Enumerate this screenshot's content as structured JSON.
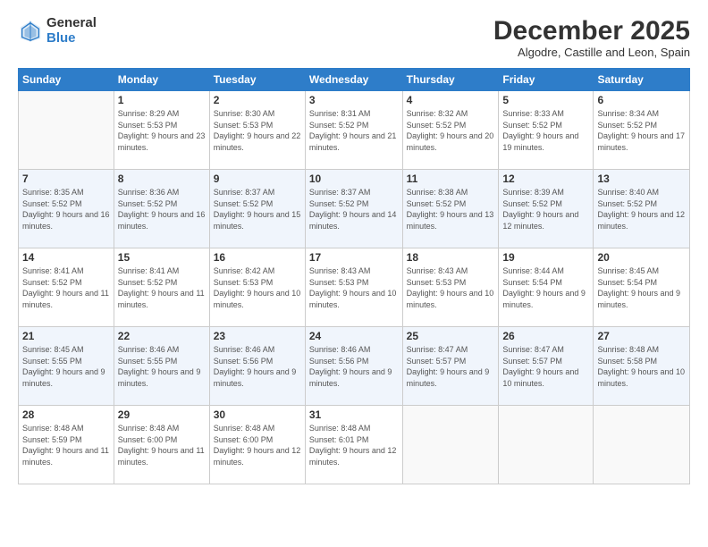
{
  "header": {
    "logo_general": "General",
    "logo_blue": "Blue",
    "month_title": "December 2025",
    "subtitle": "Algodre, Castille and Leon, Spain"
  },
  "weekdays": [
    "Sunday",
    "Monday",
    "Tuesday",
    "Wednesday",
    "Thursday",
    "Friday",
    "Saturday"
  ],
  "weeks": [
    [
      {
        "day": "",
        "sunrise": "",
        "sunset": "",
        "daylight": ""
      },
      {
        "day": "1",
        "sunrise": "Sunrise: 8:29 AM",
        "sunset": "Sunset: 5:53 PM",
        "daylight": "Daylight: 9 hours and 23 minutes."
      },
      {
        "day": "2",
        "sunrise": "Sunrise: 8:30 AM",
        "sunset": "Sunset: 5:53 PM",
        "daylight": "Daylight: 9 hours and 22 minutes."
      },
      {
        "day": "3",
        "sunrise": "Sunrise: 8:31 AM",
        "sunset": "Sunset: 5:52 PM",
        "daylight": "Daylight: 9 hours and 21 minutes."
      },
      {
        "day": "4",
        "sunrise": "Sunrise: 8:32 AM",
        "sunset": "Sunset: 5:52 PM",
        "daylight": "Daylight: 9 hours and 20 minutes."
      },
      {
        "day": "5",
        "sunrise": "Sunrise: 8:33 AM",
        "sunset": "Sunset: 5:52 PM",
        "daylight": "Daylight: 9 hours and 19 minutes."
      },
      {
        "day": "6",
        "sunrise": "Sunrise: 8:34 AM",
        "sunset": "Sunset: 5:52 PM",
        "daylight": "Daylight: 9 hours and 17 minutes."
      }
    ],
    [
      {
        "day": "7",
        "sunrise": "Sunrise: 8:35 AM",
        "sunset": "Sunset: 5:52 PM",
        "daylight": "Daylight: 9 hours and 16 minutes."
      },
      {
        "day": "8",
        "sunrise": "Sunrise: 8:36 AM",
        "sunset": "Sunset: 5:52 PM",
        "daylight": "Daylight: 9 hours and 16 minutes."
      },
      {
        "day": "9",
        "sunrise": "Sunrise: 8:37 AM",
        "sunset": "Sunset: 5:52 PM",
        "daylight": "Daylight: 9 hours and 15 minutes."
      },
      {
        "day": "10",
        "sunrise": "Sunrise: 8:37 AM",
        "sunset": "Sunset: 5:52 PM",
        "daylight": "Daylight: 9 hours and 14 minutes."
      },
      {
        "day": "11",
        "sunrise": "Sunrise: 8:38 AM",
        "sunset": "Sunset: 5:52 PM",
        "daylight": "Daylight: 9 hours and 13 minutes."
      },
      {
        "day": "12",
        "sunrise": "Sunrise: 8:39 AM",
        "sunset": "Sunset: 5:52 PM",
        "daylight": "Daylight: 9 hours and 12 minutes."
      },
      {
        "day": "13",
        "sunrise": "Sunrise: 8:40 AM",
        "sunset": "Sunset: 5:52 PM",
        "daylight": "Daylight: 9 hours and 12 minutes."
      }
    ],
    [
      {
        "day": "14",
        "sunrise": "Sunrise: 8:41 AM",
        "sunset": "Sunset: 5:52 PM",
        "daylight": "Daylight: 9 hours and 11 minutes."
      },
      {
        "day": "15",
        "sunrise": "Sunrise: 8:41 AM",
        "sunset": "Sunset: 5:52 PM",
        "daylight": "Daylight: 9 hours and 11 minutes."
      },
      {
        "day": "16",
        "sunrise": "Sunrise: 8:42 AM",
        "sunset": "Sunset: 5:53 PM",
        "daylight": "Daylight: 9 hours and 10 minutes."
      },
      {
        "day": "17",
        "sunrise": "Sunrise: 8:43 AM",
        "sunset": "Sunset: 5:53 PM",
        "daylight": "Daylight: 9 hours and 10 minutes."
      },
      {
        "day": "18",
        "sunrise": "Sunrise: 8:43 AM",
        "sunset": "Sunset: 5:53 PM",
        "daylight": "Daylight: 9 hours and 10 minutes."
      },
      {
        "day": "19",
        "sunrise": "Sunrise: 8:44 AM",
        "sunset": "Sunset: 5:54 PM",
        "daylight": "Daylight: 9 hours and 9 minutes."
      },
      {
        "day": "20",
        "sunrise": "Sunrise: 8:45 AM",
        "sunset": "Sunset: 5:54 PM",
        "daylight": "Daylight: 9 hours and 9 minutes."
      }
    ],
    [
      {
        "day": "21",
        "sunrise": "Sunrise: 8:45 AM",
        "sunset": "Sunset: 5:55 PM",
        "daylight": "Daylight: 9 hours and 9 minutes."
      },
      {
        "day": "22",
        "sunrise": "Sunrise: 8:46 AM",
        "sunset": "Sunset: 5:55 PM",
        "daylight": "Daylight: 9 hours and 9 minutes."
      },
      {
        "day": "23",
        "sunrise": "Sunrise: 8:46 AM",
        "sunset": "Sunset: 5:56 PM",
        "daylight": "Daylight: 9 hours and 9 minutes."
      },
      {
        "day": "24",
        "sunrise": "Sunrise: 8:46 AM",
        "sunset": "Sunset: 5:56 PM",
        "daylight": "Daylight: 9 hours and 9 minutes."
      },
      {
        "day": "25",
        "sunrise": "Sunrise: 8:47 AM",
        "sunset": "Sunset: 5:57 PM",
        "daylight": "Daylight: 9 hours and 9 minutes."
      },
      {
        "day": "26",
        "sunrise": "Sunrise: 8:47 AM",
        "sunset": "Sunset: 5:57 PM",
        "daylight": "Daylight: 9 hours and 10 minutes."
      },
      {
        "day": "27",
        "sunrise": "Sunrise: 8:48 AM",
        "sunset": "Sunset: 5:58 PM",
        "daylight": "Daylight: 9 hours and 10 minutes."
      }
    ],
    [
      {
        "day": "28",
        "sunrise": "Sunrise: 8:48 AM",
        "sunset": "Sunset: 5:59 PM",
        "daylight": "Daylight: 9 hours and 11 minutes."
      },
      {
        "day": "29",
        "sunrise": "Sunrise: 8:48 AM",
        "sunset": "Sunset: 6:00 PM",
        "daylight": "Daylight: 9 hours and 11 minutes."
      },
      {
        "day": "30",
        "sunrise": "Sunrise: 8:48 AM",
        "sunset": "Sunset: 6:00 PM",
        "daylight": "Daylight: 9 hours and 12 minutes."
      },
      {
        "day": "31",
        "sunrise": "Sunrise: 8:48 AM",
        "sunset": "Sunset: 6:01 PM",
        "daylight": "Daylight: 9 hours and 12 minutes."
      },
      {
        "day": "",
        "sunrise": "",
        "sunset": "",
        "daylight": ""
      },
      {
        "day": "",
        "sunrise": "",
        "sunset": "",
        "daylight": ""
      },
      {
        "day": "",
        "sunrise": "",
        "sunset": "",
        "daylight": ""
      }
    ]
  ]
}
